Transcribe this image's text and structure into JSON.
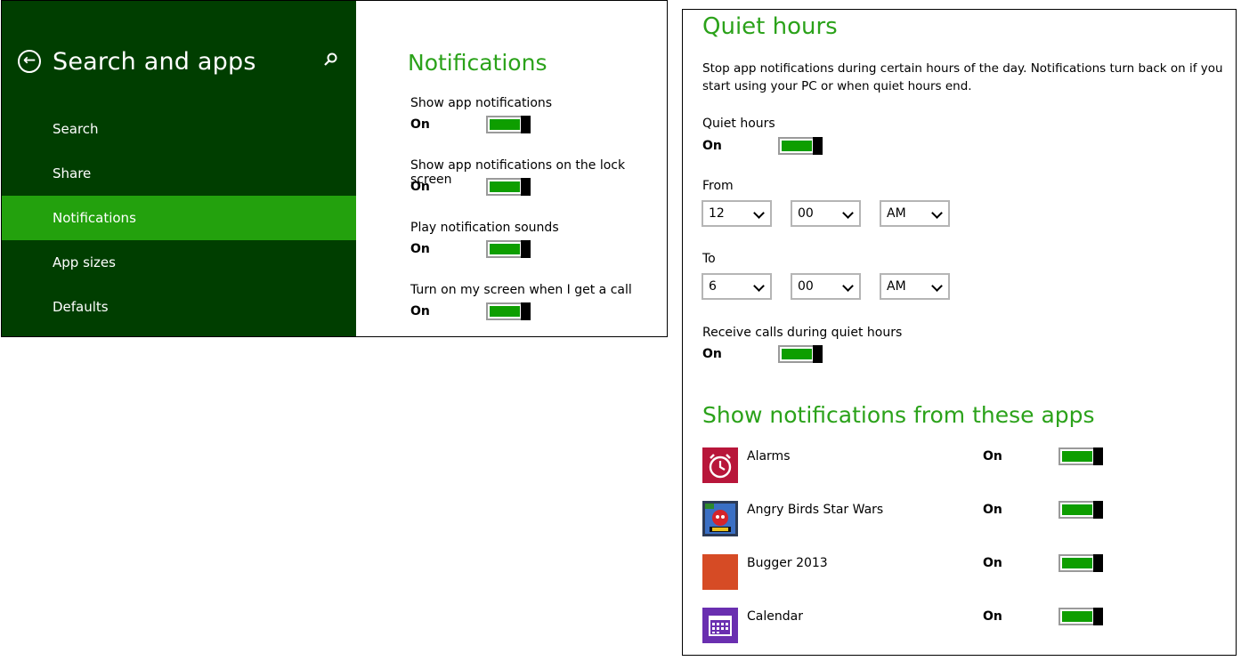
{
  "left_window": {
    "sidebar": {
      "title": "Search and apps",
      "back_icon": "back-arrow-icon",
      "search_icon": "search-icon",
      "items": [
        {
          "label": "Search",
          "selected": false
        },
        {
          "label": "Share",
          "selected": false
        },
        {
          "label": "Notifications",
          "selected": true
        },
        {
          "label": "App sizes",
          "selected": false
        },
        {
          "label": "Defaults",
          "selected": false
        }
      ]
    },
    "main": {
      "title": "Notifications",
      "settings": [
        {
          "label": "Show app notifications",
          "state": "On"
        },
        {
          "label": "Show app notifications on the lock screen",
          "state": "On"
        },
        {
          "label": "Play notification sounds",
          "state": "On"
        },
        {
          "label": "Turn on my screen when I get a call",
          "state": "On"
        }
      ]
    }
  },
  "right_window": {
    "quiet_hours": {
      "title": "Quiet hours",
      "description": "Stop app notifications during certain hours of the day. Notifications turn back on if you start using your PC or when quiet hours end.",
      "toggle_label": "Quiet hours",
      "toggle_state": "On",
      "from_label": "From",
      "from": {
        "hour": "12",
        "minute": "00",
        "ampm": "AM"
      },
      "to_label": "To",
      "to": {
        "hour": "6",
        "minute": "00",
        "ampm": "AM"
      },
      "calls_label": "Receive calls during quiet hours",
      "calls_state": "On"
    },
    "apps_section": {
      "title": "Show notifications from these apps",
      "apps": [
        {
          "name": "Alarms",
          "state": "On",
          "icon": "alarm-clock-icon",
          "color": "#b8163a"
        },
        {
          "name": "Angry Birds Star Wars",
          "state": "On",
          "icon": "angry-birds-star-wars-icon",
          "color": "#2b3a55"
        },
        {
          "name": "Bugger 2013",
          "state": "On",
          "icon": "bugger-2013-icon",
          "color": "#d64b25"
        },
        {
          "name": "Calendar",
          "state": "On",
          "icon": "calendar-icon",
          "color": "#6a2fb0"
        }
      ]
    }
  },
  "colors": {
    "sidebar_bg": "#003e00",
    "selected_bg": "#23a10d",
    "accent": "#2ba21a",
    "toggle_fill": "#0e9e00"
  }
}
